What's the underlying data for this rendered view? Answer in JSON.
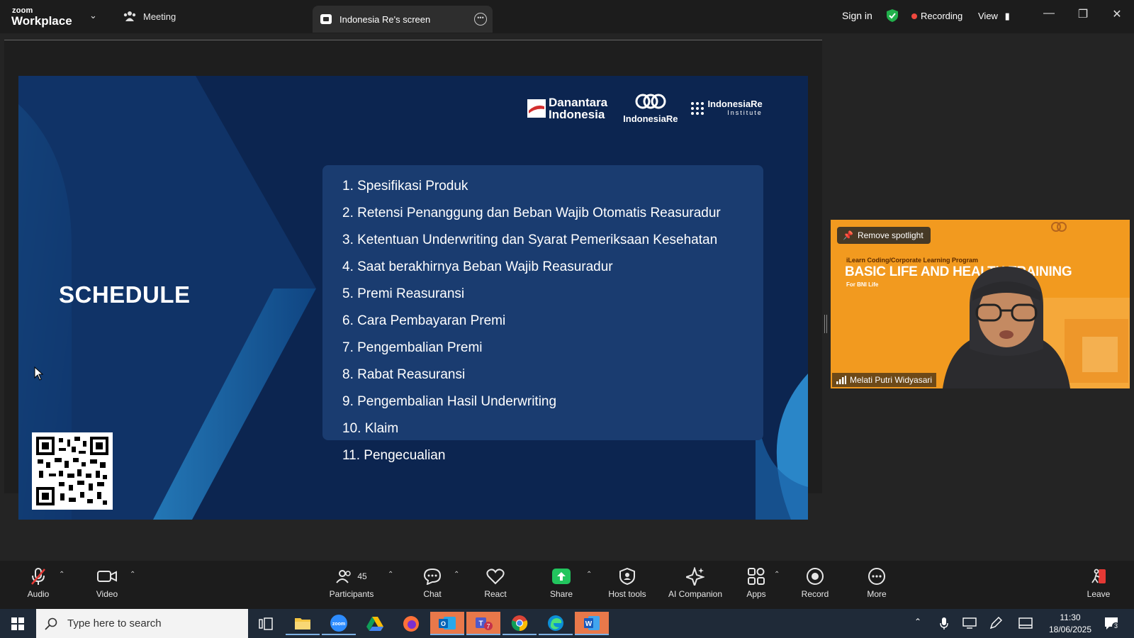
{
  "titlebar": {
    "logo_small": "zoom",
    "logo_big": "Workplace",
    "tab_meeting": "Meeting",
    "tab_screen": "Indonesia Re's screen",
    "sign_in": "Sign in",
    "recording": "Recording",
    "view": "View"
  },
  "slide": {
    "title": "SCHEDULE",
    "logos": {
      "danantara_1": "Danantara",
      "danantara_2": "Indonesia",
      "indonesiare": "IndonesiaRe",
      "institute_1": "IndonesiaRe",
      "institute_2": "Institute"
    },
    "items": [
      "1. Spesifikasi Produk",
      "2. Retensi Penanggung dan Beban Wajib Otomatis Reasuradur",
      "3. Ketentuan Underwriting dan Syarat Pemeriksaan Kesehatan",
      "4. Saat berakhirnya Beban Wajib Reasuradur",
      "5. Premi Reasuransi",
      "6. Cara Pembayaran Premi",
      "7. Pengembalian Premi",
      "8. Rabat Reasuransi",
      "9. Pengembalian Hasil Underwriting",
      "10. Klaim",
      "11. Pengecualian"
    ]
  },
  "video": {
    "spotlight_button": "Remove spotlight",
    "program": "iLearn Coding/Corporate Learning Program",
    "headline": "BASIC LIFE AND HEALTH TRAINING",
    "sub": "For BNI Life",
    "participant_name": "Melati Putri Widyasari"
  },
  "toolbar": {
    "audio": "Audio",
    "video": "Video",
    "participants": "Participants",
    "participants_count": "45",
    "chat": "Chat",
    "react": "React",
    "share": "Share",
    "host_tools": "Host tools",
    "ai_companion": "AI Companion",
    "apps": "Apps",
    "record": "Record",
    "more": "More",
    "leave": "Leave"
  },
  "taskbar": {
    "search_placeholder": "Type here to search",
    "time": "11:30",
    "date": "18/06/2025",
    "notification_count": "3"
  },
  "colors": {
    "slide_bg": "#0c2550",
    "video_bg": "#f29a1f",
    "recording_dot": "#f0483e",
    "share_green": "#22c55e"
  }
}
